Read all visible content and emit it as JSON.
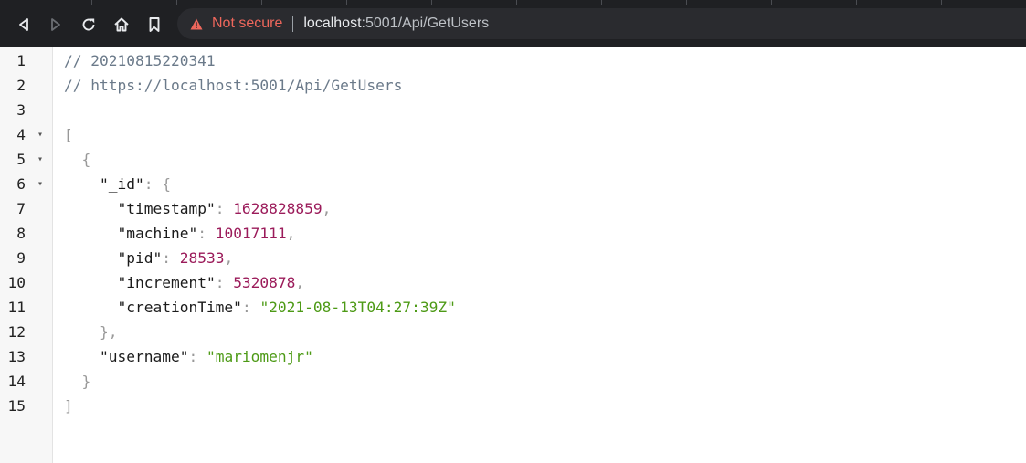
{
  "browser": {
    "security_label": "Not secure",
    "url_host": "localhost",
    "url_path": ":5001/Api/GetUsers",
    "icons": [
      "back-icon",
      "forward-icon",
      "reload-icon",
      "home-icon",
      "bookmark-icon",
      "warning-icon"
    ]
  },
  "colors": {
    "chrome_bg": "#1f2023",
    "omnibox_bg": "#2a2b2f",
    "warning": "#ee675c",
    "number": "#9b1b5a",
    "string": "#4d9a16",
    "comment": "#6b7a8a"
  },
  "lines": [
    {
      "n": "1",
      "fold": "",
      "tokens": [
        {
          "t": "comment",
          "v": "// 20210815220341"
        }
      ]
    },
    {
      "n": "2",
      "fold": "",
      "tokens": [
        {
          "t": "comment",
          "v": "// https://localhost:5001/Api/GetUsers"
        }
      ]
    },
    {
      "n": "3",
      "fold": "",
      "tokens": []
    },
    {
      "n": "4",
      "fold": "▾",
      "tokens": [
        {
          "t": "punct",
          "v": "["
        }
      ]
    },
    {
      "n": "5",
      "fold": "▾",
      "tokens": [
        {
          "t": "ws",
          "v": "  "
        },
        {
          "t": "punct",
          "v": "{"
        }
      ]
    },
    {
      "n": "6",
      "fold": "▾",
      "tokens": [
        {
          "t": "ws",
          "v": "    "
        },
        {
          "t": "key",
          "v": "\"_id\""
        },
        {
          "t": "punct",
          "v": ": {"
        }
      ]
    },
    {
      "n": "7",
      "fold": "",
      "tokens": [
        {
          "t": "ws",
          "v": "      "
        },
        {
          "t": "key",
          "v": "\"timestamp\""
        },
        {
          "t": "punct",
          "v": ": "
        },
        {
          "t": "num",
          "v": "1628828859"
        },
        {
          "t": "punct",
          "v": ","
        }
      ]
    },
    {
      "n": "8",
      "fold": "",
      "tokens": [
        {
          "t": "ws",
          "v": "      "
        },
        {
          "t": "key",
          "v": "\"machine\""
        },
        {
          "t": "punct",
          "v": ": "
        },
        {
          "t": "num",
          "v": "10017111"
        },
        {
          "t": "punct",
          "v": ","
        }
      ]
    },
    {
      "n": "9",
      "fold": "",
      "tokens": [
        {
          "t": "ws",
          "v": "      "
        },
        {
          "t": "key",
          "v": "\"pid\""
        },
        {
          "t": "punct",
          "v": ": "
        },
        {
          "t": "num",
          "v": "28533"
        },
        {
          "t": "punct",
          "v": ","
        }
      ]
    },
    {
      "n": "10",
      "fold": "",
      "tokens": [
        {
          "t": "ws",
          "v": "      "
        },
        {
          "t": "key",
          "v": "\"increment\""
        },
        {
          "t": "punct",
          "v": ": "
        },
        {
          "t": "num",
          "v": "5320878"
        },
        {
          "t": "punct",
          "v": ","
        }
      ]
    },
    {
      "n": "11",
      "fold": "",
      "tokens": [
        {
          "t": "ws",
          "v": "      "
        },
        {
          "t": "key",
          "v": "\"creationTime\""
        },
        {
          "t": "punct",
          "v": ": "
        },
        {
          "t": "str",
          "v": "\"2021-08-13T04:27:39Z\""
        }
      ]
    },
    {
      "n": "12",
      "fold": "",
      "tokens": [
        {
          "t": "ws",
          "v": "    "
        },
        {
          "t": "punct",
          "v": "},"
        }
      ]
    },
    {
      "n": "13",
      "fold": "",
      "tokens": [
        {
          "t": "ws",
          "v": "    "
        },
        {
          "t": "key",
          "v": "\"username\""
        },
        {
          "t": "punct",
          "v": ": "
        },
        {
          "t": "str",
          "v": "\"mariomenjr\""
        }
      ]
    },
    {
      "n": "14",
      "fold": "",
      "tokens": [
        {
          "t": "ws",
          "v": "  "
        },
        {
          "t": "punct",
          "v": "}"
        }
      ]
    },
    {
      "n": "15",
      "fold": "",
      "tokens": [
        {
          "t": "punct",
          "v": "]"
        }
      ]
    }
  ]
}
